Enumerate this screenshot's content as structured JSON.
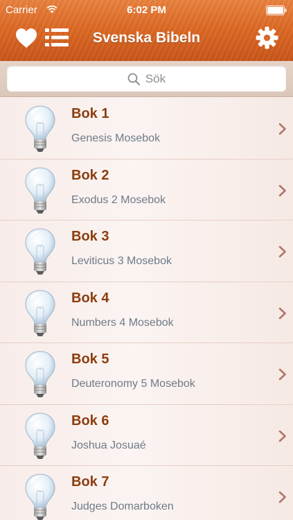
{
  "status_bar": {
    "carrier": "Carrier",
    "time": "6:02 PM"
  },
  "nav": {
    "title": "Svenska Bibeln",
    "left_icons": [
      "heart-icon",
      "list-icon"
    ],
    "right_icon": "gear-icon"
  },
  "search": {
    "placeholder": "Sök",
    "value": ""
  },
  "books": [
    {
      "title": "Bok 1",
      "subtitle": "Genesis Mosebok"
    },
    {
      "title": "Bok 2",
      "subtitle": "Exodus 2 Mosebok"
    },
    {
      "title": "Bok 3",
      "subtitle": "Leviticus 3 Mosebok"
    },
    {
      "title": "Bok 4",
      "subtitle": "Numbers 4 Mosebok"
    },
    {
      "title": "Bok 5",
      "subtitle": "Deuteronomy 5 Mosebok"
    },
    {
      "title": "Bok 6",
      "subtitle": "Joshua Josuaé"
    },
    {
      "title": "Bok 7",
      "subtitle": "Judges Domarboken"
    }
  ],
  "colors": {
    "nav_orange": "#dd6a25",
    "title_brown": "#8b3d0e",
    "subtitle_gray": "#6e7b88",
    "chevron": "#b0756a"
  }
}
